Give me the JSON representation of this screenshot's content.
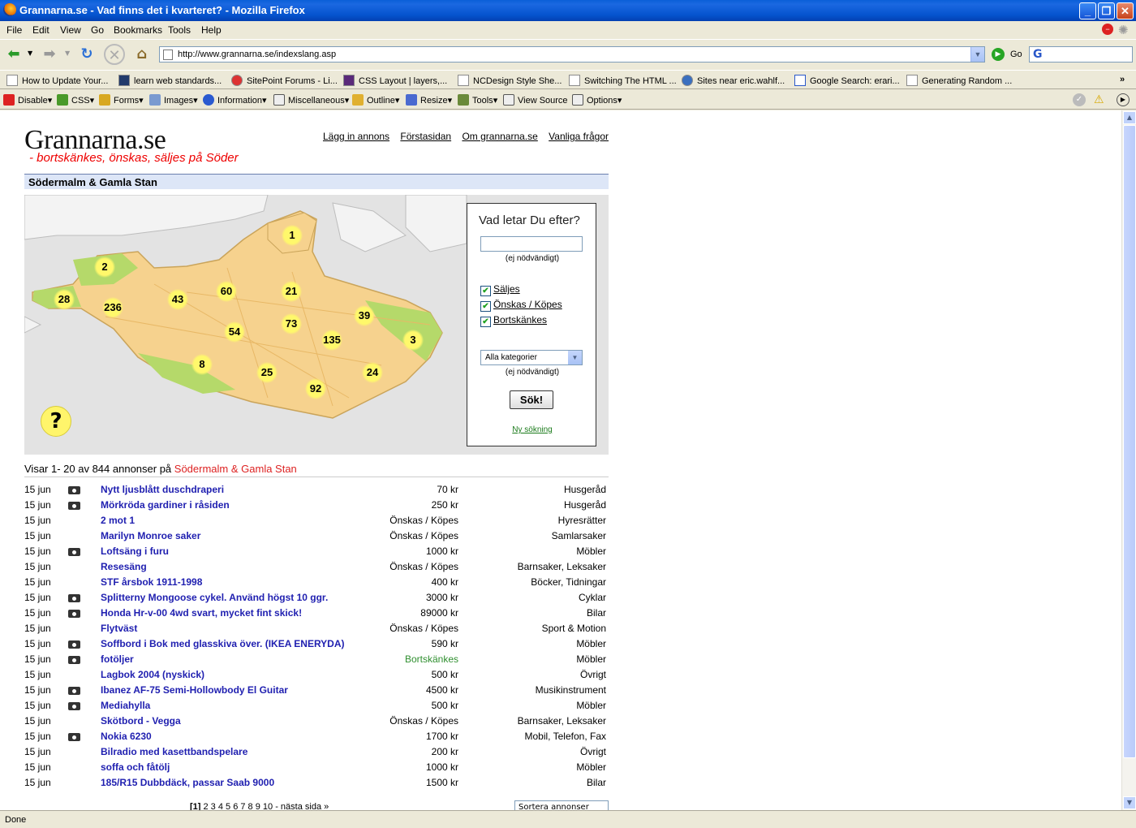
{
  "window": {
    "title": "Grannarna.se - Vad finns det i kvarteret? - Mozilla Firefox"
  },
  "menu": [
    "File",
    "Edit",
    "View",
    "Go",
    "Bookmarks",
    "Tools",
    "Help"
  ],
  "nav": {
    "url": "http://www.grannarna.se/indexslang.asp",
    "go_label": "Go"
  },
  "bookmarks": [
    "How to Update Your...",
    "learn web standards...",
    "SitePoint Forums - Li...",
    "CSS Layout | layers,...",
    "NCDesign Style She...",
    "Switching The HTML ...",
    "Sites near eric.wahlf...",
    "Google Search: erari...",
    "Generating Random ..."
  ],
  "webdev": [
    "Disable",
    "CSS",
    "Forms",
    "Images",
    "Information",
    "Miscellaneous",
    "Outline",
    "Resize",
    "Tools",
    "View Source",
    "Options"
  ],
  "site": {
    "logo": "Grannarna.se",
    "tagline": "- bortskänkes, önskas, säljes på Söder",
    "links": [
      "Lägg in annons",
      "Förstasidan",
      "Om grannarna.se",
      "Vanliga frågor"
    ],
    "area_title": "Södermalm & Gamla Stan"
  },
  "map": {
    "pins": [
      "1",
      "2",
      "28",
      "236",
      "43",
      "60",
      "21",
      "73",
      "54",
      "135",
      "39",
      "3",
      "8",
      "25",
      "24",
      "92"
    ],
    "help": "?"
  },
  "search": {
    "heading": "Vad letar Du efter?",
    "optional1": "(ej nödvändigt)",
    "checks": [
      "Säljes",
      "Önskas / Köpes",
      "Bortskänkes"
    ],
    "category": "Alla kategorier",
    "optional2": "(ej nödvändigt)",
    "button": "Sök!",
    "reset": "Ny sökning"
  },
  "results": {
    "prefix": "Visar 1- 20 av 844 annonser på ",
    "area": "Södermalm & Gamla Stan",
    "rows": [
      {
        "date": "15 jun",
        "photo": true,
        "title": "Nytt ljusblått duschdraperi",
        "price": "70 kr",
        "cat": "Husgeråd"
      },
      {
        "date": "15 jun",
        "photo": true,
        "title": "Mörkröda gardiner i råsiden",
        "price": "250 kr",
        "cat": "Husgeråd"
      },
      {
        "date": "15 jun",
        "photo": false,
        "title": "2 mot 1",
        "price": "Önskas / Köpes",
        "cat": "Hyresrätter"
      },
      {
        "date": "15 jun",
        "photo": false,
        "title": "Marilyn Monroe saker",
        "price": "Önskas / Köpes",
        "cat": "Samlarsaker"
      },
      {
        "date": "15 jun",
        "photo": true,
        "title": "Loftsäng i furu",
        "price": "1000 kr",
        "cat": "Möbler"
      },
      {
        "date": "15 jun",
        "photo": false,
        "title": "Resesäng",
        "price": "Önskas / Köpes",
        "cat": "Barnsaker, Leksaker"
      },
      {
        "date": "15 jun",
        "photo": false,
        "title": "STF årsbok 1911-1998",
        "price": "400 kr",
        "cat": "Böcker, Tidningar"
      },
      {
        "date": "15 jun",
        "photo": true,
        "title": "Splitterny Mongoose cykel. Använd högst 10 ggr.",
        "price": "3000 kr",
        "cat": "Cyklar"
      },
      {
        "date": "15 jun",
        "photo": true,
        "title": "Honda Hr-v-00 4wd svart, mycket fint skick!",
        "price": "89000 kr",
        "cat": "Bilar"
      },
      {
        "date": "15 jun",
        "photo": false,
        "title": "Flytväst",
        "price": "Önskas / Köpes",
        "cat": "Sport & Motion"
      },
      {
        "date": "15 jun",
        "photo": true,
        "title": "Soffbord i Bok med glasskiva över. (IKEA ENERYDA)",
        "price": "590 kr",
        "cat": "Möbler"
      },
      {
        "date": "15 jun",
        "photo": true,
        "title": "fotöljer",
        "price": "Bortskänkes",
        "cat": "Möbler",
        "free": true
      },
      {
        "date": "15 jun",
        "photo": false,
        "title": "Lagbok 2004 (nyskick)",
        "price": "500 kr",
        "cat": "Övrigt"
      },
      {
        "date": "15 jun",
        "photo": true,
        "title": "Ibanez AF-75 Semi-Hollowbody El Guitar",
        "price": "4500 kr",
        "cat": "Musikinstrument"
      },
      {
        "date": "15 jun",
        "photo": true,
        "title": "Mediahylla",
        "price": "500 kr",
        "cat": "Möbler"
      },
      {
        "date": "15 jun",
        "photo": false,
        "title": "Skötbord - Vegga",
        "price": "Önskas / Köpes",
        "cat": "Barnsaker, Leksaker"
      },
      {
        "date": "15 jun",
        "photo": true,
        "title": "Nokia 6230",
        "price": "1700 kr",
        "cat": "Mobil, Telefon, Fax"
      },
      {
        "date": "15 jun",
        "photo": false,
        "title": "Bilradio med kasettbandspelare",
        "price": "200 kr",
        "cat": "Övrigt"
      },
      {
        "date": "15 jun",
        "photo": false,
        "title": "soffa och fåtölj",
        "price": "1000 kr",
        "cat": "Möbler"
      },
      {
        "date": "15 jun",
        "photo": false,
        "title": "185/R15 Dubbdäck, passar Saab 9000",
        "price": "1500 kr",
        "cat": "Bilar"
      }
    ],
    "pager_current": "[1]",
    "pager_rest": " 2 3 4 5 6 7 8 9 10 - nästa sida »",
    "sort": "Sortera annonser"
  },
  "status": "Done"
}
